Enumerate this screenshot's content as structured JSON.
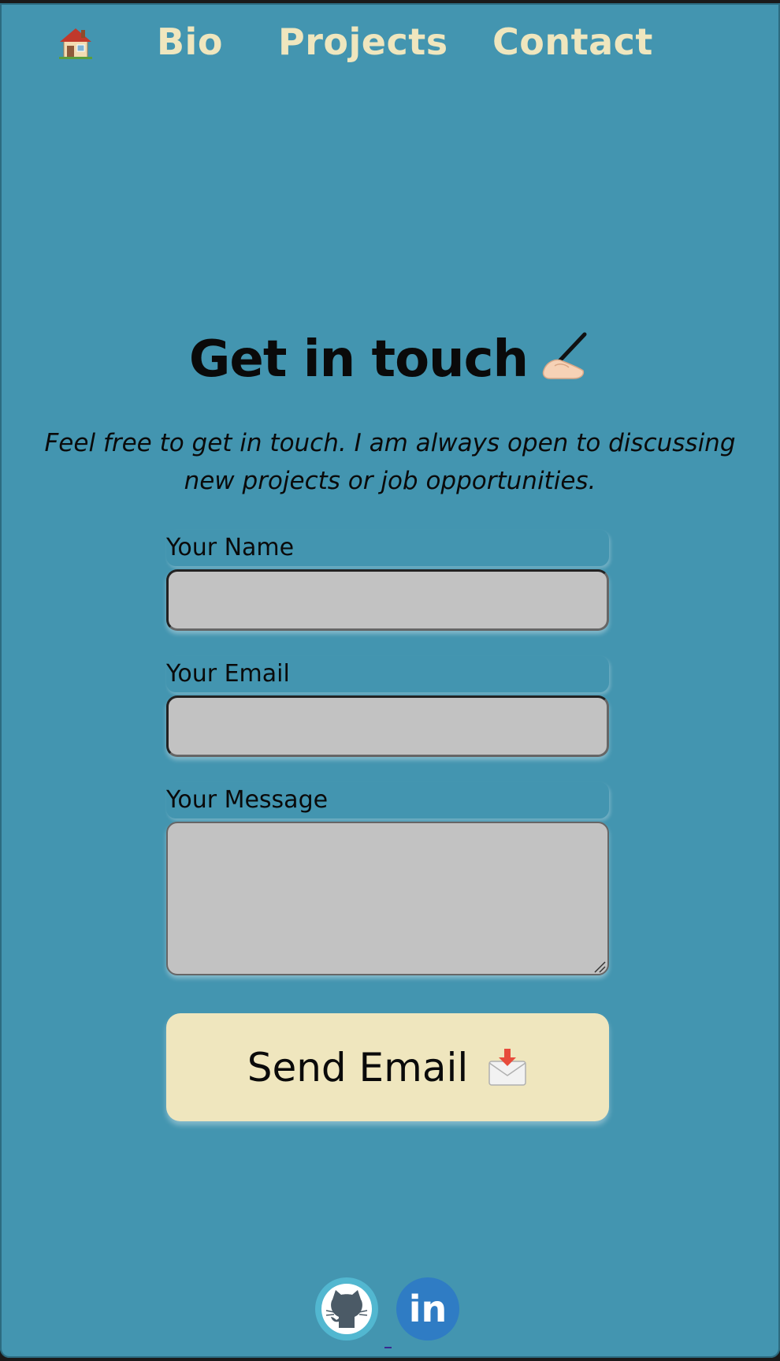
{
  "nav": {
    "home_icon": "house-icon",
    "items": [
      {
        "label": "Bio"
      },
      {
        "label": "Projects"
      },
      {
        "label": "Contact"
      }
    ]
  },
  "hero": {
    "title": "Get in touch",
    "title_icon": "writing-hand-icon",
    "intro": "Feel free to get in touch. I am always open to discussing new projects or job opportunities."
  },
  "form": {
    "name_label": "Your Name",
    "name_value": "",
    "email_label": "Your Email",
    "email_value": "",
    "message_label": "Your Message",
    "message_value": "",
    "submit_label": "Send Email",
    "submit_icon": "envelope-download-icon"
  },
  "footer": {
    "links": [
      {
        "icon": "github-icon"
      },
      {
        "icon": "linkedin-icon",
        "label": "in"
      }
    ]
  },
  "colors": {
    "background": "#4395b0",
    "accent": "#efe6be",
    "input_fill": "#c2c2c2",
    "text": "#0a0a0a",
    "github_circle": "#52b7d0",
    "linkedin_circle": "#2f7cc4"
  }
}
